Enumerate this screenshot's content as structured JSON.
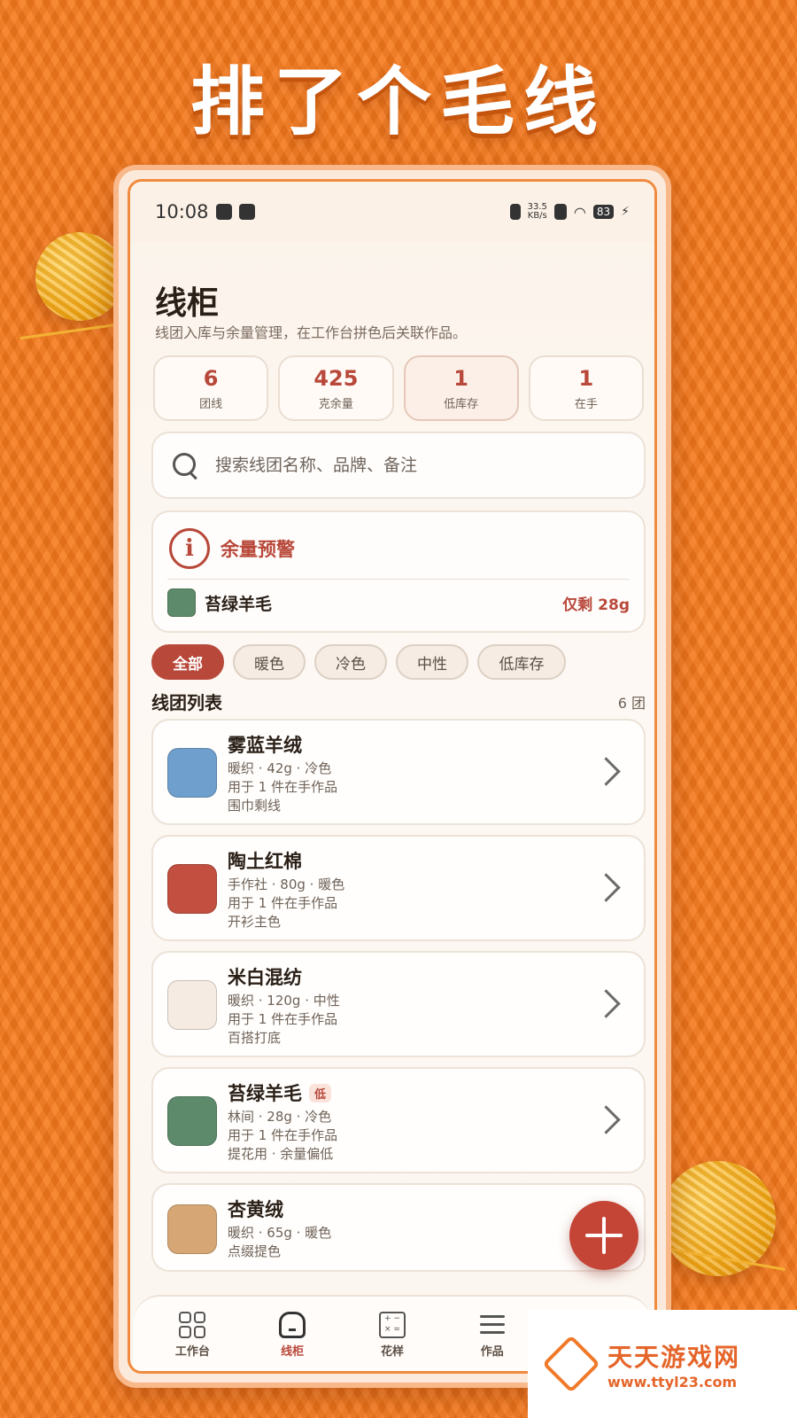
{
  "headline": "排了个毛线",
  "status_bar": {
    "time": "10:08",
    "net_speed_value": "33.5",
    "net_speed_unit": "KB/s",
    "battery": "83"
  },
  "page": {
    "title": "线柜",
    "subtitle": "线团入库与余量管理，在工作台拼色后关联作品。"
  },
  "stats": [
    {
      "value": "6",
      "label": "团线"
    },
    {
      "value": "425",
      "label": "克余量"
    },
    {
      "value": "1",
      "label": "低库存"
    },
    {
      "value": "1",
      "label": "在手"
    }
  ],
  "search": {
    "placeholder": "搜索线团名称、品牌、备注"
  },
  "alert": {
    "title": "余量预警",
    "yarn_name": "苔绿羊毛",
    "remaining": "仅剩 28g",
    "swatch_color": "#5d8a6b"
  },
  "filters": [
    "全部",
    "暖色",
    "冷色",
    "中性",
    "低库存"
  ],
  "list": {
    "title": "线团列表",
    "count": "6 团",
    "low_badge": "低",
    "items": [
      {
        "name": "雾蓝羊绒",
        "meta": "暖织 · 42g · 冷色",
        "usage": "用于 1 件在手作品",
        "note": "围巾剩线",
        "color": "#6f9fcc"
      },
      {
        "name": "陶土红棉",
        "meta": "手作社 · 80g · 暖色",
        "usage": "用于 1 件在手作品",
        "note": "开衫主色",
        "color": "#c24f40"
      },
      {
        "name": "米白混纺",
        "meta": "暖织 · 120g · 中性",
        "usage": "用于 1 件在手作品",
        "note": "百搭打底",
        "color": "#f6ebe2"
      },
      {
        "name": "苔绿羊毛",
        "meta": "林间 · 28g · 冷色",
        "usage": "用于 1 件在手作品",
        "note": "提花用 · 余量偏低",
        "color": "#5d8a6b",
        "low": true
      },
      {
        "name": "杏黄绒",
        "meta": "暖织 · 65g · 暖色",
        "note": "点缀提色",
        "color": "#d6a774"
      }
    ]
  },
  "nav": [
    {
      "label": "工作台",
      "icon": "grid-icon"
    },
    {
      "label": "线柜",
      "icon": "home-icon",
      "active": true
    },
    {
      "label": "花样",
      "icon": "calculator-icon"
    },
    {
      "label": "作品",
      "icon": "list-icon"
    }
  ],
  "watermark": {
    "name": "天天游戏网",
    "url": "www.ttyl23.com"
  },
  "colors": {
    "accent": "#b8483a",
    "background": "#f77a1c",
    "yarn_ball": "#f2a91a"
  }
}
